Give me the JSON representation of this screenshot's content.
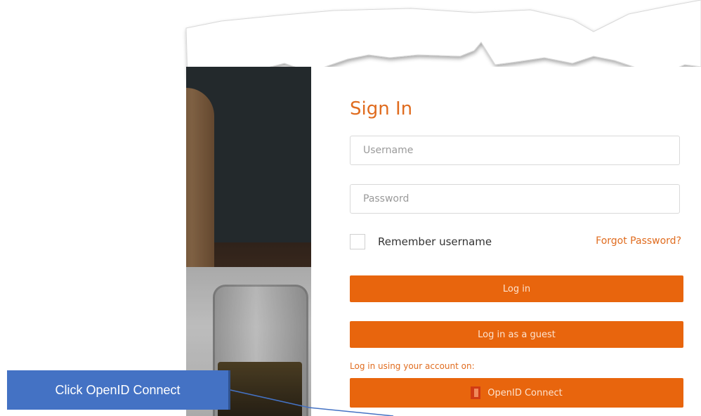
{
  "signin": {
    "title": "Sign In",
    "username_placeholder": "Username",
    "password_placeholder": "Password",
    "remember_label": "Remember username",
    "forgot_label": "Forgot Password?",
    "login_label": "Log in",
    "guest_label": "Log in as a guest",
    "using_text": "Log in using your account on:",
    "openid_label": "OpenID Connect",
    "openid_icon": "office-icon"
  },
  "callout": {
    "text": "Click OpenID  Connect"
  },
  "colors": {
    "accent": "#e8650d",
    "title": "#e06c1f",
    "callout": "#4472c4"
  }
}
